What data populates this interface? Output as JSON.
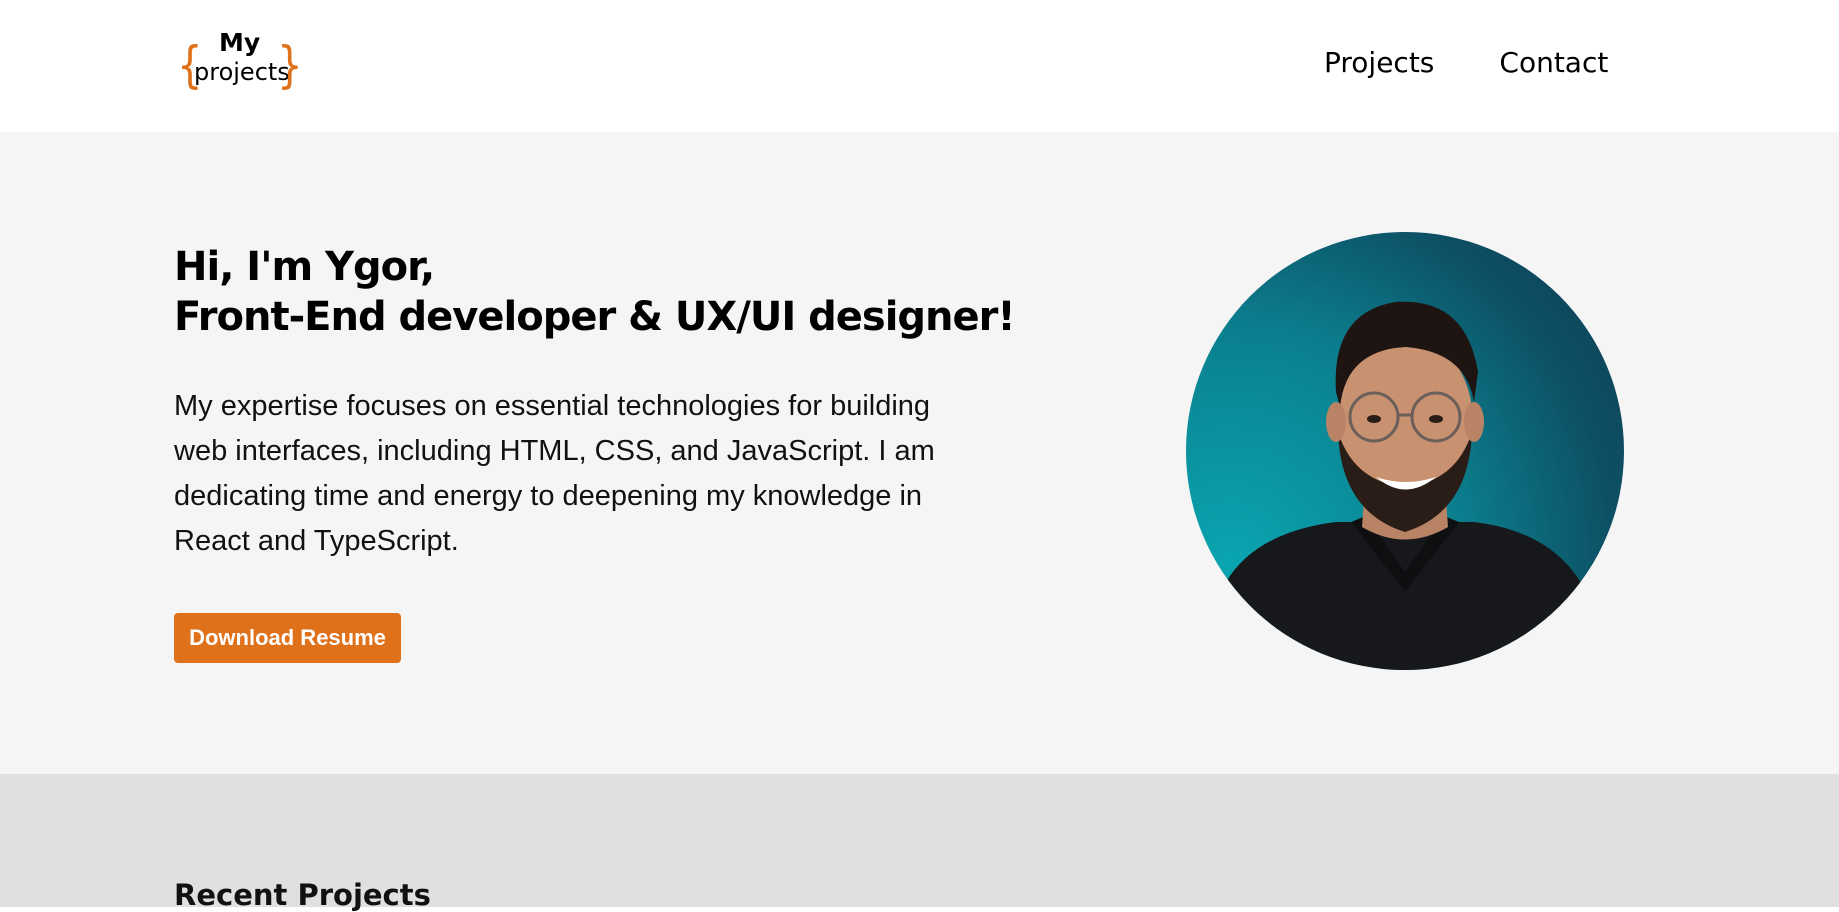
{
  "logo": {
    "brace_left": "{",
    "brace_right": "}",
    "line1": "My",
    "line2": "projects"
  },
  "nav": [
    {
      "label": "Projects"
    },
    {
      "label": "Contact"
    }
  ],
  "hero": {
    "headline_line1": "Hi, I'm Ygor,",
    "headline_line2": "Front-End developer & UX/UI designer!",
    "intro": "My expertise focuses on essential technologies for building web interfaces, including HTML, CSS, and JavaScript. I am dedicating time and energy to deepening my knowledge in React and TypeScript.",
    "button_label": "Download Resume"
  },
  "recent": {
    "title": "Recent Projects"
  },
  "colors": {
    "accent": "#e0711b",
    "hero_bg": "#f5f5f5",
    "section_bg": "#e0e0e0"
  }
}
